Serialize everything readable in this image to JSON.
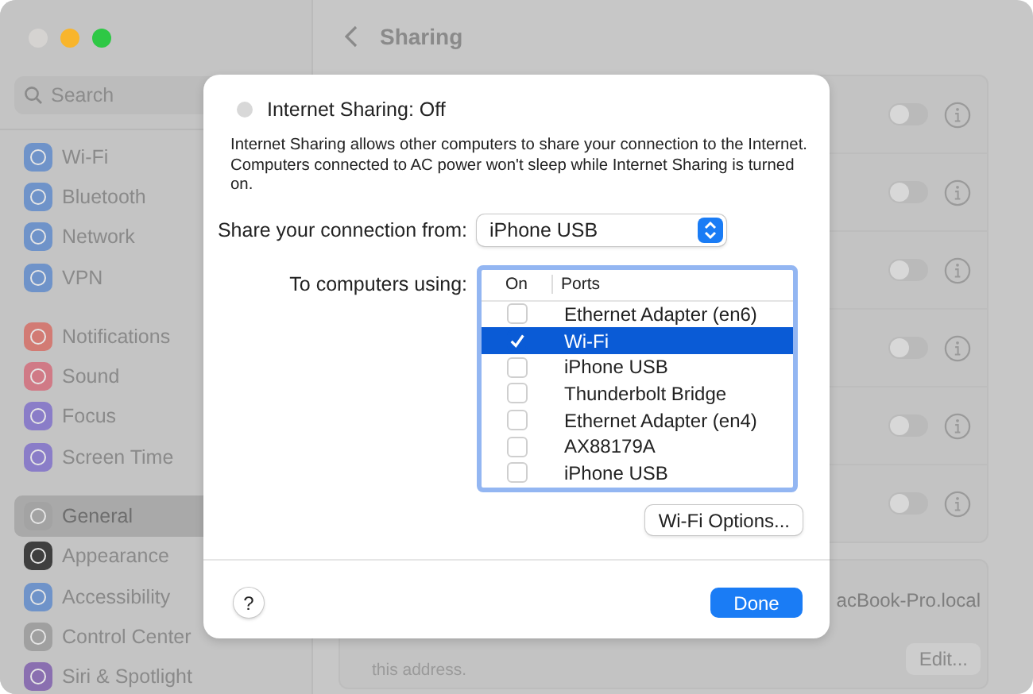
{
  "window": {
    "title": "Sharing"
  },
  "sidebar": {
    "search": {
      "placeholder": "Search"
    },
    "groups": [
      [
        {
          "label": "Wi-Fi",
          "color": "#6f93c9",
          "selected": false
        },
        {
          "label": "Bluetooth",
          "color": "#6f93c9",
          "selected": false
        },
        {
          "label": "Network",
          "color": "#6f93c9",
          "selected": false
        },
        {
          "label": "VPN",
          "color": "#6f93c9",
          "selected": false
        }
      ],
      [
        {
          "label": "Notifications",
          "color": "#d27b74",
          "selected": false
        },
        {
          "label": "Sound",
          "color": "#d07a86",
          "selected": false
        },
        {
          "label": "Focus",
          "color": "#8a7dc8",
          "selected": false
        },
        {
          "label": "Screen Time",
          "color": "#8a7dc8",
          "selected": false
        }
      ],
      [
        {
          "label": "General",
          "color": "#a3a3a3",
          "selected": true
        },
        {
          "label": "Appearance",
          "color": "#3f3f3f",
          "selected": false
        },
        {
          "label": "Accessibility",
          "color": "#6f93c9",
          "selected": false
        },
        {
          "label": "Control Center",
          "color": "#a0a0a0",
          "selected": false
        },
        {
          "label": "Siri & Spotlight",
          "color": "#8a6fb0",
          "selected": false
        }
      ]
    ]
  },
  "services": [
    {
      "on": false
    },
    {
      "on": false
    },
    {
      "on": false
    },
    {
      "on": false
    },
    {
      "on": false
    },
    {
      "on": false
    }
  ],
  "hostname": {
    "value": "acBook-Pro.local",
    "note": "this address.",
    "button": "Edit..."
  },
  "dialog": {
    "status": {
      "label": "Internet Sharing: Off",
      "on": false
    },
    "description": "Internet Sharing allows other computers to share your connection to the Internet. Computers connected to AC power won't sleep while Internet Sharing is turned on.",
    "share_from": {
      "label": "Share your connection from:",
      "value": "iPhone USB"
    },
    "to_computers": {
      "label": "To computers using:",
      "columns": [
        "On",
        "Ports"
      ],
      "rows": [
        {
          "port": "Ethernet Adapter (en6)",
          "checked": false,
          "selected": false
        },
        {
          "port": "Wi-Fi",
          "checked": true,
          "selected": true
        },
        {
          "port": "iPhone USB",
          "checked": false,
          "selected": false
        },
        {
          "port": "Thunderbolt Bridge",
          "checked": false,
          "selected": false
        },
        {
          "port": "Ethernet Adapter (en4)",
          "checked": false,
          "selected": false
        },
        {
          "port": "AX88179A",
          "checked": false,
          "selected": false
        },
        {
          "port": "iPhone USB",
          "checked": false,
          "selected": false
        }
      ]
    },
    "options_button": "Wi-Fi Options...",
    "help_button": "?",
    "done_button": "Done"
  }
}
